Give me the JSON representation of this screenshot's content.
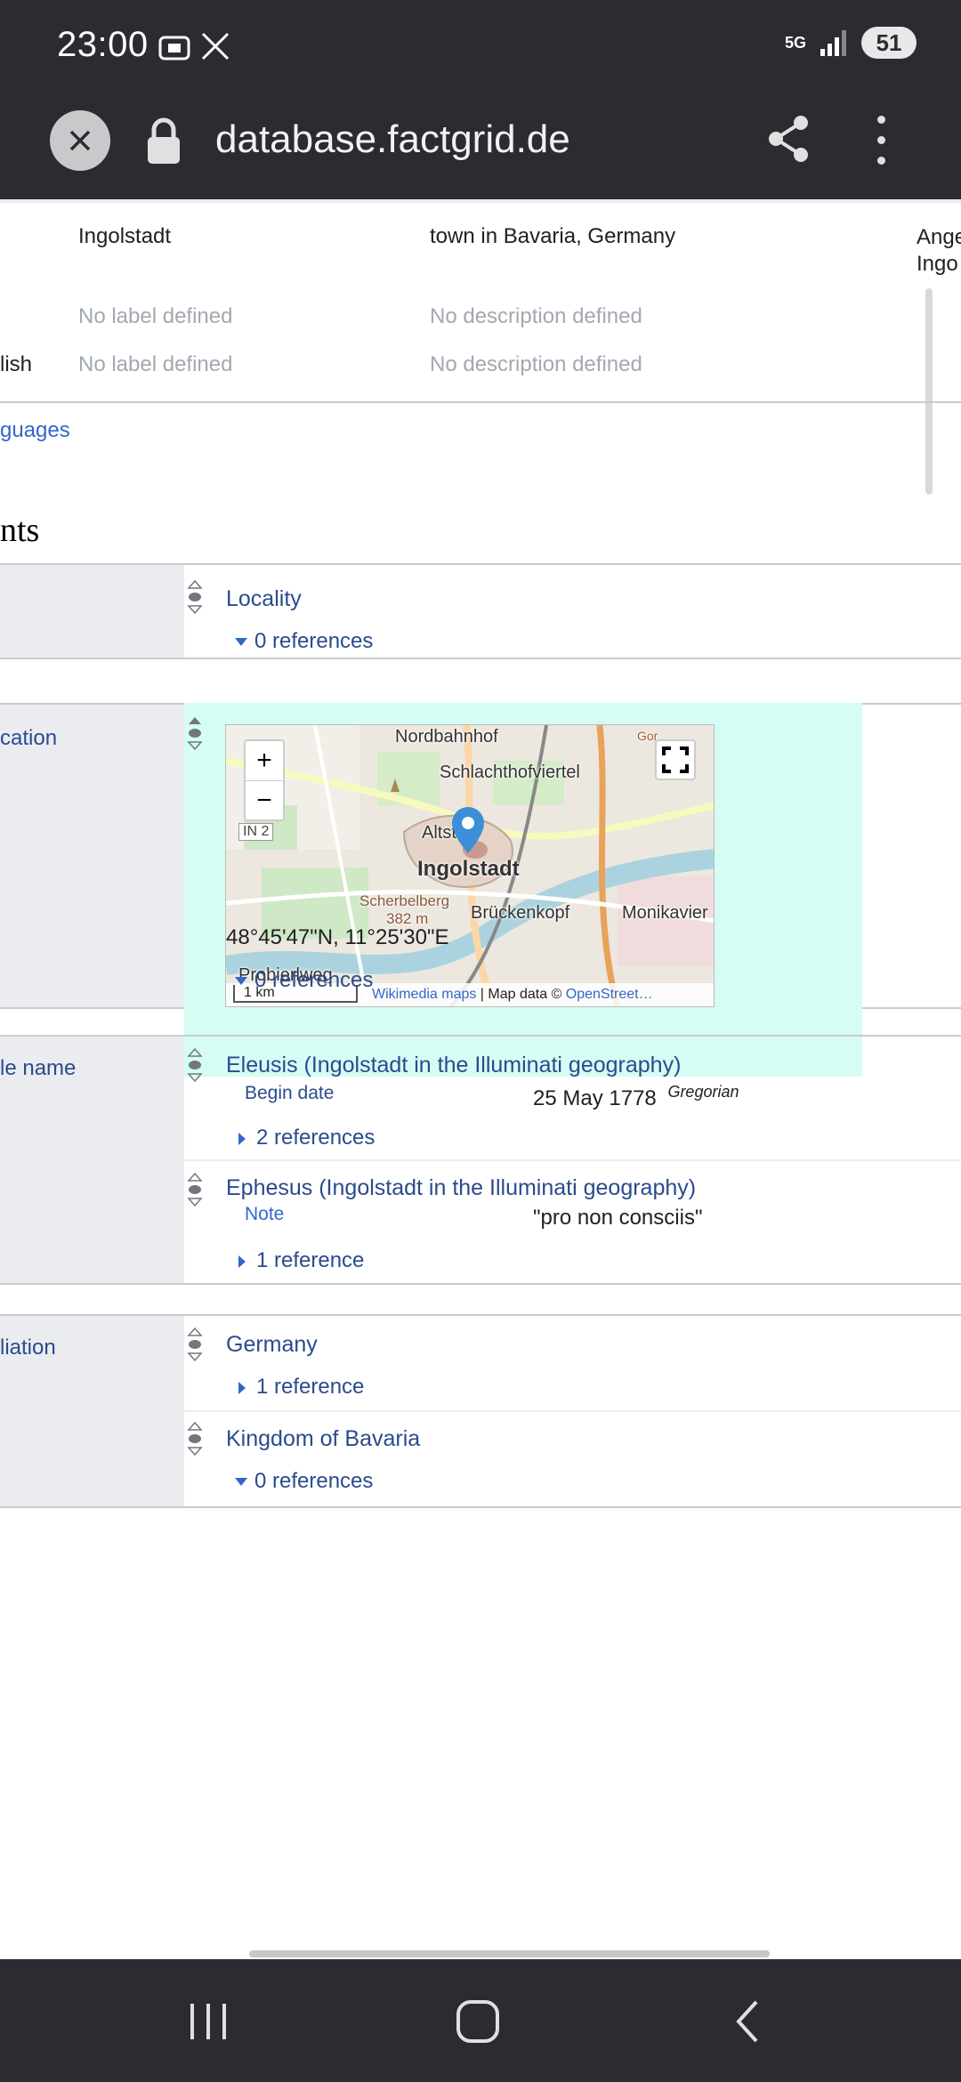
{
  "status_bar": {
    "time": "23:00",
    "network": "5G",
    "battery": "51"
  },
  "url_bar": {
    "url": "database.factgrid.de"
  },
  "labels_table": {
    "rows": [
      {
        "lang": "",
        "label": "Ingolstadt",
        "description": "town in Bavaria, Germany",
        "aliases": "Ange\nIngo"
      },
      {
        "lang": "",
        "label": "No label defined",
        "description": "No description defined"
      },
      {
        "lang": "lish",
        "label": "No label defined",
        "description": "No description defined"
      }
    ],
    "more_languages": "guages"
  },
  "section_title": "nts",
  "statements": [
    {
      "property": "",
      "values": [
        {
          "value": "Locality",
          "refs": "0 references",
          "refs_expanded": true
        }
      ]
    },
    {
      "property": "cation",
      "map": {
        "zoom_in": "+",
        "zoom_out": "−",
        "road_label": "IN 2",
        "scale": "1 km",
        "attribution_link": "Wikimedia maps",
        "attribution_text": " | Map data © ",
        "attribution_link2": "OpenStreet…",
        "places": [
          "Nordbahnhof",
          "Schlachthofviertel",
          "Altst",
          "Ingolstadt",
          "Scherbelberg",
          "382 m",
          "Brückenkopf",
          "Monikavier",
          "Probierlweg",
          "Gor"
        ]
      },
      "coordinates": "48°45'47\"N, 11°25'30\"E",
      "refs": "0 references"
    },
    {
      "property": "le name",
      "values": [
        {
          "value": "Eleusis (Ingolstadt in the Illuminati geography)",
          "qualifier": "Begin date",
          "qualifier_value": "25 May 1778",
          "qualifier_sup": "Gregorian",
          "refs": "2 references"
        },
        {
          "value": "Ephesus (Ingolstadt in the Illuminati geography)",
          "qualifier": "Note",
          "qualifier_value": "\"pro non consciis\"",
          "refs": "1 reference"
        }
      ]
    },
    {
      "property": "liation",
      "values": [
        {
          "value": "Germany",
          "refs": "1 reference"
        },
        {
          "value": "Kingdom of Bavaria",
          "refs": "0 references"
        }
      ]
    }
  ]
}
